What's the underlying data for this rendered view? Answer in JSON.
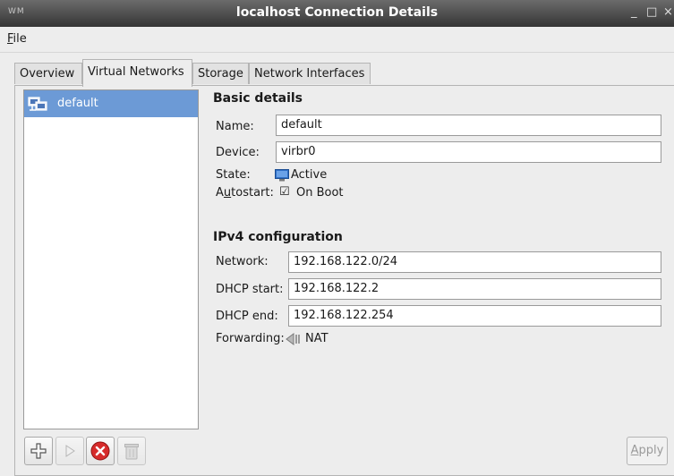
{
  "window": {
    "wm_label": "WM",
    "title": "localhost Connection Details",
    "minimize": "_",
    "maximize": "□",
    "close": "×"
  },
  "menu": {
    "file_accel": "F",
    "file_rest": "ile"
  },
  "tabs": [
    "Overview",
    "Virtual Networks",
    "Storage",
    "Network Interfaces"
  ],
  "active_tab": "Virtual Networks",
  "networks": [
    {
      "name": "default",
      "selected": true
    }
  ],
  "basic": {
    "heading": "Basic details",
    "name_label": "Name:",
    "name_value": "default",
    "device_label": "Device:",
    "device_value": "virbr0",
    "state_label": "State:",
    "state_value": "Active",
    "autostart_label_pre": "A",
    "autostart_label_accel": "u",
    "autostart_label_post": "tostart:",
    "autostart_check": "☑",
    "autostart_value": "On Boot"
  },
  "ipv4": {
    "heading": "IPv4 configuration",
    "network_label": "Network:",
    "network_value": "192.168.122.0/24",
    "dhcp_start_label": "DHCP start:",
    "dhcp_start_value": "192.168.122.2",
    "dhcp_end_label": "DHCP end:",
    "dhcp_end_value": "192.168.122.254",
    "forwarding_label": "Forwarding:",
    "forwarding_value": "NAT"
  },
  "toolbar": {
    "add_icon": "add-icon",
    "start_icon": "play-icon",
    "stop_icon": "stop-icon",
    "delete_icon": "trash-icon"
  },
  "apply": {
    "accel": "A",
    "rest": "pply"
  },
  "colors": {
    "titlebar": "#3f3f3f",
    "selection": "#6c9ad6",
    "stop_red": "#d62b2b",
    "active_green": "#2e7d32"
  }
}
